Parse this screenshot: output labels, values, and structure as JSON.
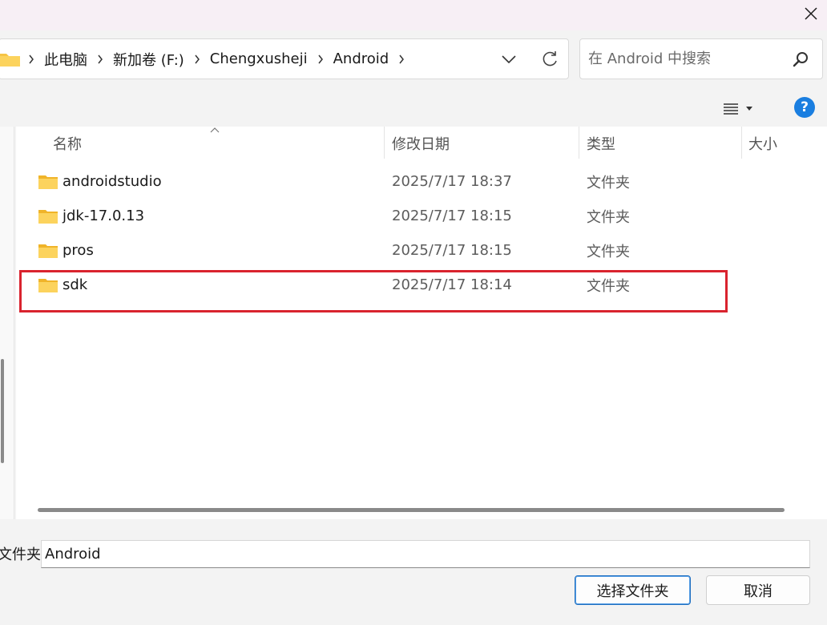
{
  "window": {
    "close_label": "✕"
  },
  "address": {
    "crumbs": [
      "此电脑",
      "新加卷 (F:)",
      "Chengxusheji",
      "Android"
    ]
  },
  "search": {
    "placeholder": "在 Android 中搜索"
  },
  "columns": {
    "name": "名称",
    "date": "修改日期",
    "type": "类型",
    "size": "大小"
  },
  "rows": [
    {
      "name": "androidstudio",
      "date": "2025/7/17 18:37",
      "type": "文件夹"
    },
    {
      "name": "jdk-17.0.13",
      "date": "2025/7/17 18:15",
      "type": "文件夹"
    },
    {
      "name": "pros",
      "date": "2025/7/17 18:15",
      "type": "文件夹"
    },
    {
      "name": "sdk",
      "date": "2025/7/17 18:14",
      "type": "文件夹"
    }
  ],
  "folder_field": {
    "label": "文件夹:",
    "value": "Android"
  },
  "buttons": {
    "select": "选择文件夹",
    "cancel": "取消"
  },
  "toolbar": {
    "help": "?"
  },
  "colors": {
    "highlight": "#d9232e",
    "accent": "#1a7ee0",
    "folder": "#f6c445"
  }
}
